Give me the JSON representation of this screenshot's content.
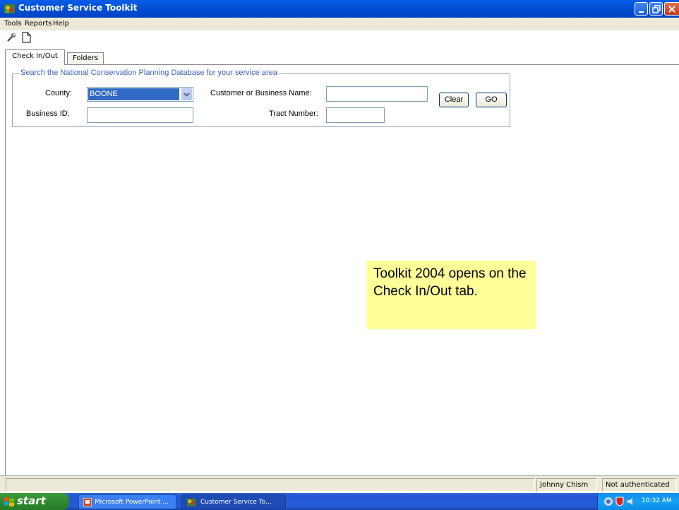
{
  "window": {
    "title": "Customer Service Toolkit"
  },
  "menu": [
    "Tools",
    "Reports",
    "Help"
  ],
  "tabs": {
    "active": "Check In/Out",
    "inactive": "Folders"
  },
  "search": {
    "legend": "Search the National Conservation Planning Database for your service area",
    "county_label": "County:",
    "county_value": "BOONE",
    "customer_label": "Customer or Business Name:",
    "customer_value": "",
    "business_id_label": "Business ID:",
    "business_id_value": "",
    "tract_label": "Tract Number:",
    "tract_value": "",
    "clear_label": "Clear",
    "go_label": "GO"
  },
  "callout": {
    "text": "Toolkit 2004 opens on the Check In/Out tab."
  },
  "status": {
    "user": "Johnny Chism",
    "auth": "Not authenticated"
  },
  "taskbar": {
    "start": "start",
    "items": [
      "Microsoft PowerPoint ...",
      "Customer Service To..."
    ],
    "clock": "10:32 AM"
  },
  "colors": {
    "title_bar": "#0152d6",
    "selection": "#316ac5",
    "callout_bg": "#ffff99",
    "legend_text": "#3a5fb8"
  }
}
